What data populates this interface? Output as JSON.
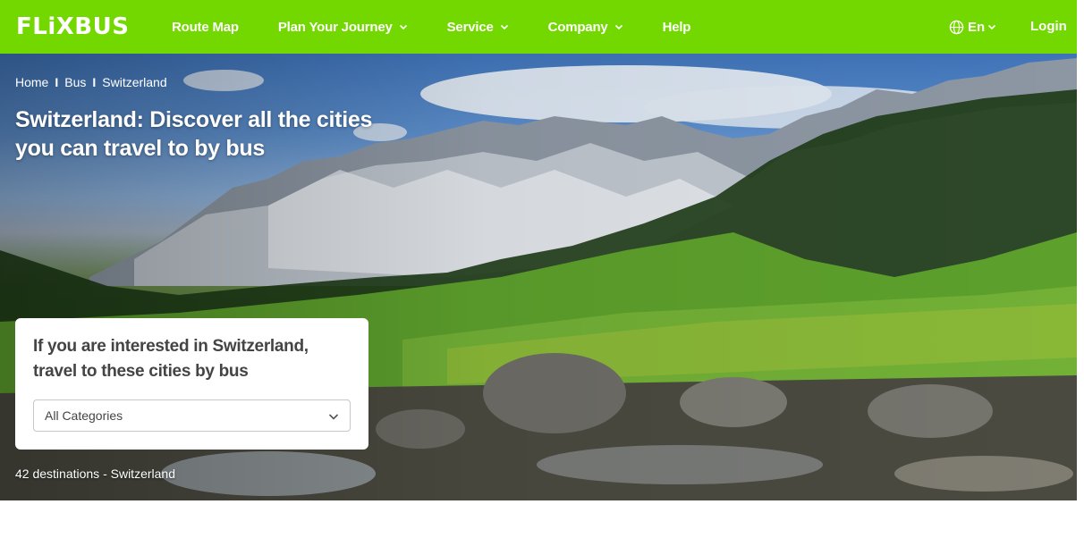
{
  "header": {
    "logo": "FLiXBUS",
    "nav": [
      {
        "label": "Route Map",
        "has_dropdown": false
      },
      {
        "label": "Plan Your Journey",
        "has_dropdown": true
      },
      {
        "label": "Service",
        "has_dropdown": true
      },
      {
        "label": "Company",
        "has_dropdown": true
      },
      {
        "label": "Help",
        "has_dropdown": false
      }
    ],
    "language": "En",
    "login": "Login",
    "accent_color": "#73d700"
  },
  "breadcrumb": {
    "items": [
      "Home",
      "Bus",
      "Switzerland"
    ],
    "separator": "I"
  },
  "hero": {
    "title": "Switzerland: Discover all the cities you can travel to by bus"
  },
  "card": {
    "title": "If you are interested in Switzerland, travel to these cities by bus",
    "select_value": "All Categories"
  },
  "destinations": "42 destinations - Switzerland"
}
